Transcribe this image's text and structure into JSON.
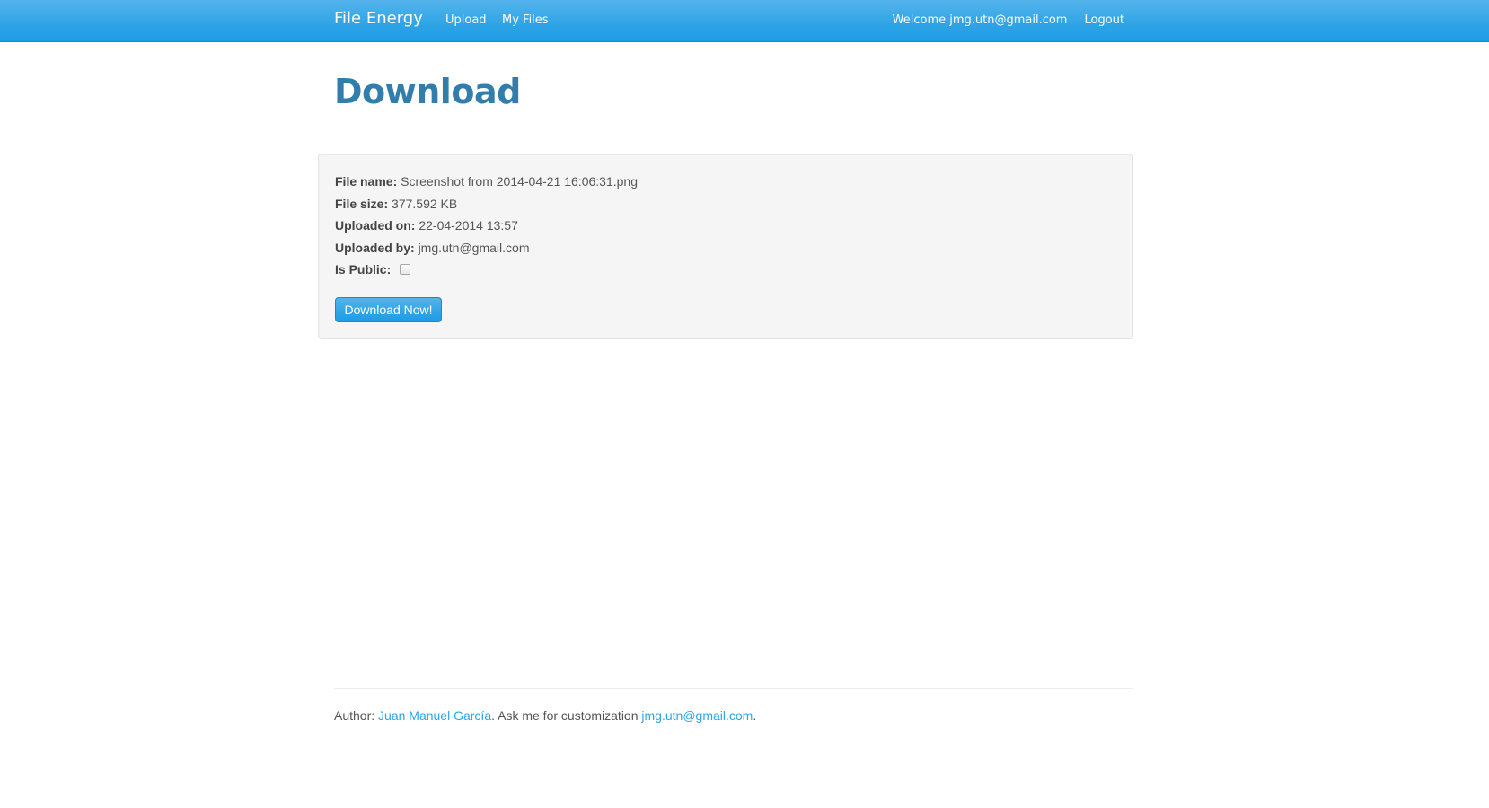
{
  "navbar": {
    "brand": "File Energy",
    "links": [
      {
        "label": "Upload"
      },
      {
        "label": "My Files"
      }
    ],
    "welcome": "Welcome jmg.utn@gmail.com",
    "logout": "Logout"
  },
  "page": {
    "title": "Download"
  },
  "file_info": {
    "name_label": "File name:",
    "name_value": "Screenshot from 2014-04-21 16:06:31.png",
    "size_label": "File size:",
    "size_value": "377.592 KB",
    "uploaded_on_label": "Uploaded on:",
    "uploaded_on_value": "22-04-2014 13:57",
    "uploaded_by_label": "Uploaded by:",
    "uploaded_by_value": "jmg.utn@gmail.com",
    "public_label": "Is Public:",
    "is_public": false
  },
  "download_button": "Download Now!",
  "footer": {
    "author_prefix": "Author:",
    "author_name": "Juan Manuel García",
    "middle_text": ". Ask me for customization",
    "email": "jmg.utn@gmail.com",
    "end": "."
  },
  "colors": {
    "navbar": "#2fa4e7",
    "title": "#317eac",
    "link": "#2fa4e7"
  }
}
